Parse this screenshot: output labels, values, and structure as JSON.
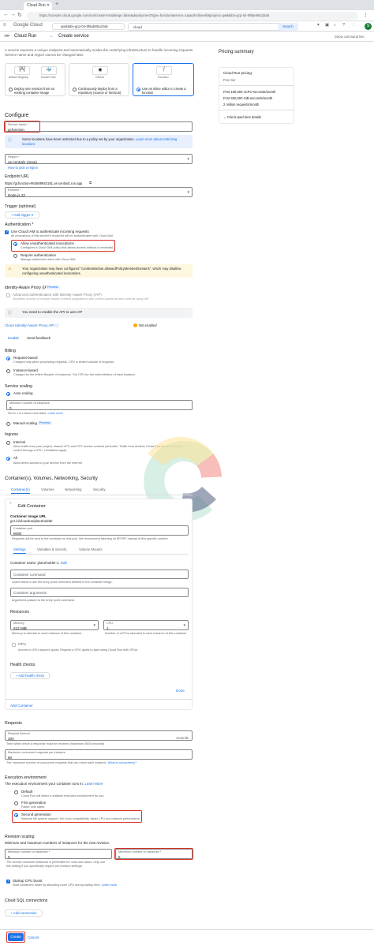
{
  "browser": {
    "tab_title": "Cloud Run",
    "url": "https://console.cloud.google.com/run/create?enableapi=false&deploymentType=function&ervice=1&authAllowAll&project=qwiklabs-gcp-04-9f6be85cd2a6",
    "search_text": "cloud",
    "search_button": "Search",
    "project": "qwiklabs-gcp-04-9f6ab85cd2a6",
    "avatar_initial": "S",
    "gc_logo": "Google Cloud"
  },
  "header": {
    "product": "Cloud Run",
    "title": "Create service",
    "right_link": "Show command line"
  },
  "intro": {
    "text": "A service exposes a unique endpoint and automatically scales the underlying infrastructure to handle incoming requests. Service name and region cannot be changed later.",
    "options": [
      {
        "icon_labels": [
          "Artifact Registry",
          "Docker Hub"
        ],
        "label": "Deploy one revision from an existing container image"
      },
      {
        "icon_labels": [
          "GitHub"
        ],
        "label": "Continuously deploy from a repository (source or function)"
      },
      {
        "icon_labels": [
          "Function"
        ],
        "label": "Use an inline editor to create a function"
      }
    ]
  },
  "pricing": {
    "title": "Pricing summary",
    "heading": "Cloud Run pricing:",
    "sub": "Free tier",
    "items": [
      "First 180,000 vCPU-seconds/month",
      "First 360,000 GiB-seconds/month",
      "2 million requests/month"
    ],
    "link": "Check paid tiers details"
  },
  "configure": {
    "title": "Configure",
    "service_name_label": "Service name *",
    "service_name_value": "gcfunction",
    "policy_note": "Some locations have been restricted due to a policy set by your organization.",
    "policy_link": "Learn more about restricting locations",
    "region_label": "Region *",
    "region_value": "us-central1 (Iowa)",
    "region_link": "How to pick a region",
    "endpoint_label": "Endpoint URL",
    "endpoint_value": "https://gcfunction-964589943181.us-central1.run.app",
    "runtime_label": "Runtime *",
    "runtime_value": "Node.js 22",
    "trigger_title": "Trigger (optional)",
    "trigger_button": "+ Add trigger ▾"
  },
  "auth": {
    "title": "Authentication *",
    "iam_label": "Use Cloud IAM to authenticate incoming requests",
    "iam_sub": "All invocations of this service's endpoint will be authenticated with Cloud IAM",
    "allow_label": "Allow unauthenticated invocations",
    "allow_sub": "Configures a Cloud IAM policy that allows access without a credential",
    "require_label": "Require authentication",
    "require_sub": "Manage authorized users with Cloud IAM.",
    "warning": "Your organization may have configured \"constraints/iam.allowedPolicyMemberDomains\", which may disallow configuring unauthenticated invocations."
  },
  "iap": {
    "title": "Identity-Aware Proxy (IAP)",
    "badge": "Preview",
    "checkbox_label": "Advanced authentication with Identity-Aware Proxy (IAP)",
    "checkbox_sub": "Simplifies access of browser based frontend applications with context-aware access controls using IAP.",
    "notice": "You need to enable the API to use IAP",
    "api_label": "Cloud Identity-Aware Proxy API",
    "api_status": "Not enabled",
    "enable": "Enable",
    "feedback": "Send feedback"
  },
  "billing": {
    "title": "Billing",
    "opt1": "Request-based",
    "opt1_sub": "Charged only when processing requests. CPU is limited outside of requests.",
    "opt2": "Instance-based",
    "opt2_sub": "Charged for the entire lifecycle of instances. Full CPU for the entire lifetime of each instance."
  },
  "scaling": {
    "title": "Service scaling",
    "auto": "Auto scaling",
    "min_label": "Minimum number of instances",
    "min_value": "0",
    "helper": "Set to 1 to reduce cold starts.",
    "learn": "Learn more",
    "manual": "Manual scaling",
    "manual_badge": "Preview"
  },
  "ingress": {
    "title": "Ingress",
    "internal": "Internal",
    "internal_sub": "Allow traffic from your project, shared VPC and VPC service controls perimeter. Traffic from another Cloud Run service must be routed through a VPC. Limitations apply.",
    "all": "All",
    "all_sub": "Allow direct access to your service from the Internet"
  },
  "containers": {
    "title": "Container(s), Volumes, Networking, Security",
    "tabs": [
      "Container(s)",
      "Volumes",
      "Networking",
      "Security"
    ],
    "edit_title": "Edit Container",
    "image_label": "Container image URL",
    "image_value": "gcr.io/cloudrun/placeholder",
    "port_label": "Container port",
    "port_value": "8080",
    "port_helper": "Requests will be sent to the container on this port. We recommend listening on $PORT instead of this specific number.",
    "subtabs": [
      "Settings",
      "Variables & Secrets",
      "Volume Mounts"
    ],
    "name_label": "Container name: placeholder-1",
    "name_edit": "Edit",
    "command_ph": "Container command",
    "command_helper": "Leave blank to use the entry point command defined in the container image.",
    "args_ph": "Container arguments",
    "args_helper": "Arguments passed to the entry point command.",
    "resources": "Resources",
    "memory_label": "Memory",
    "memory_value": "512 MiB",
    "memory_helper": "Memory to allocate to each instance of this container",
    "cpu_label": "CPU",
    "cpu_value": "1",
    "cpu_helper": "Number of vCPUs allocated to each instance of this container",
    "gpu_label": "GPU",
    "gpu_helper": "Access to GPU requires quota. Request a GPU quota to start using Cloud Run with GPUs.",
    "health_title": "Health checks",
    "health_button": "+ Add health check",
    "done": "Done",
    "add_container": "Add Container"
  },
  "requests": {
    "title": "Requests",
    "timeout_label": "Request timeout",
    "timeout_value": "300",
    "timeout_unit": "seconds",
    "timeout_helper": "Time within which a response must be returned (maximum 3600 seconds)",
    "concurrency_label": "Maximum concurrent requests per instance",
    "concurrency_value": "80",
    "concurrency_helper": "The maximum number of concurrent requests that can reach each instance.",
    "concurrency_link": "What is concurrency?"
  },
  "execution": {
    "title": "Execution environment",
    "sub": "The execution environment your container runs in.",
    "learn": "Learn More",
    "default": "Default",
    "default_sub": "Cloud Run will select a suitable execution environment for you.",
    "first": "First generation",
    "first_sub": "Faster cold starts.",
    "second": "Second generation",
    "second_sub": "Network file system support, full Linux compatibility, faster CPU and network performance."
  },
  "revision": {
    "title": "Revision scaling",
    "sub": "Minimum and maximum numbers of instances for the new revision.",
    "min_label": "Minimum number of instances *",
    "min_value": "0",
    "min_helper": "The service minimum instances is preferable for most use-cases. Only use this setting if you specifically require per-revision settings.",
    "max_label": "Maximum number of instances *",
    "max_value": "5",
    "startup_label": "Startup CPU boost",
    "startup_sub": "Start containers faster by allocating more CPU during startup time.",
    "learn": "Learn more"
  },
  "sql": {
    "title": "Cloud SQL connections",
    "button": "+ Add connection"
  },
  "footer": {
    "create": "Create",
    "cancel": "Cancel"
  },
  "colors": {
    "accent": "#1a73e8",
    "highlight": "#d93025",
    "warning_bg": "#fef7e0",
    "info_bg": "#e8f0fe"
  }
}
